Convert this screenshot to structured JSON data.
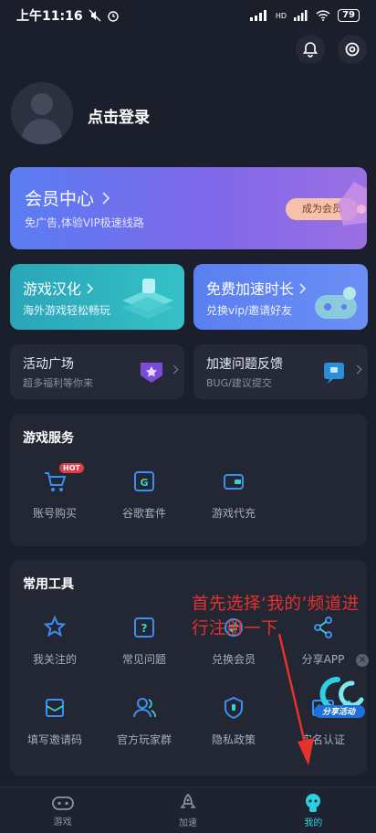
{
  "status_bar": {
    "time": "上午11:16",
    "battery": "79",
    "network": "HD"
  },
  "profile": {
    "login_text": "点击登录"
  },
  "vip": {
    "title": "会员中心",
    "subtitle": "免广告,体验VIP极速线路",
    "button": "成为会员"
  },
  "cards": {
    "localization": {
      "title": "游戏汉化",
      "subtitle": "海外游戏轻松畅玩"
    },
    "free_boost": {
      "title": "免费加速时长",
      "subtitle": "兑换vip/邀请好友"
    },
    "activity": {
      "title": "活动广场",
      "subtitle": "超多福利等你来"
    },
    "feedback": {
      "title": "加速问题反馈",
      "subtitle": "BUG/建议提交"
    }
  },
  "game_services": {
    "title": "游戏服务",
    "items": [
      {
        "label": "账号购买",
        "icon": "cart-icon",
        "badge": "HOT"
      },
      {
        "label": "谷歌套件",
        "icon": "google-kit-icon"
      },
      {
        "label": "游戏代充",
        "icon": "wallet-icon"
      }
    ]
  },
  "tools": {
    "title": "常用工具",
    "items": [
      {
        "label": "我关注的",
        "icon": "star-icon"
      },
      {
        "label": "常见问题",
        "icon": "question-icon"
      },
      {
        "label": "兑换会员",
        "icon": "exchange-icon"
      },
      {
        "label": "分享APP",
        "icon": "share-icon"
      },
      {
        "label": "填写邀请码",
        "icon": "invite-icon"
      },
      {
        "label": "官方玩家群",
        "icon": "group-icon"
      },
      {
        "label": "隐私政策",
        "icon": "shield-icon"
      },
      {
        "label": "实名认证",
        "icon": "id-card-icon"
      }
    ]
  },
  "annotation": {
    "text": "首先选择‘我的’频道进行注册一下"
  },
  "share_badge": {
    "text": "分享活动"
  },
  "bottom_nav": [
    {
      "label": "游戏",
      "icon": "gamepad-icon"
    },
    {
      "label": "加速",
      "icon": "rocket-icon"
    },
    {
      "label": "我的",
      "icon": "profile-icon",
      "active": true
    }
  ],
  "colors": {
    "accent": "#2bd1e0",
    "annotation": "#e5322d",
    "vip_button": "#f6c2ac"
  }
}
